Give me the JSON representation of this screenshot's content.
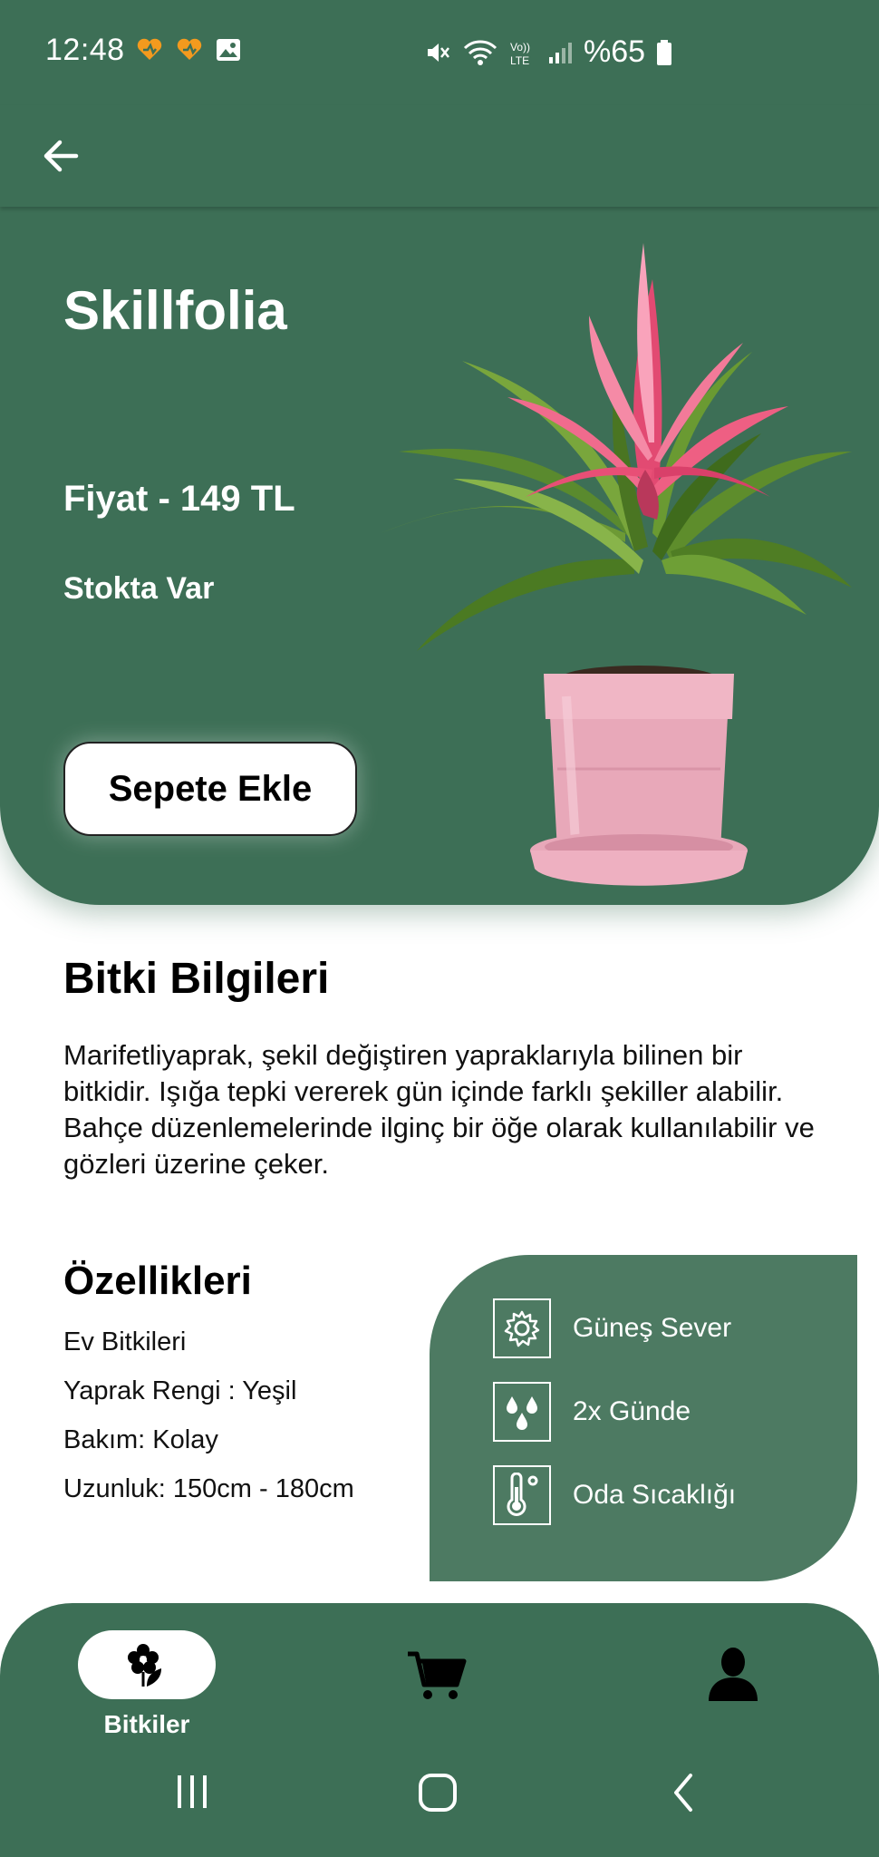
{
  "status_bar": {
    "time": "12:48",
    "battery": "%65",
    "left_icons": [
      "heart-notification-icon",
      "heart-notification-icon",
      "gallery-icon"
    ],
    "right_icons": [
      "mute-icon",
      "wifi-icon",
      "volte-icon",
      "signal-icon",
      "battery-icon"
    ]
  },
  "app_bar": {
    "back_icon": "arrow-left-icon"
  },
  "product": {
    "name": "Skillfolia",
    "price": "Fiyat - 149 TL",
    "stock": "Stokta Var",
    "add_to_cart": "Sepete Ekle",
    "image": "potted-pink-bromeliad"
  },
  "info": {
    "title": "Bitki Bilgileri",
    "description": "Marifetliyaprak, şekil değiştiren yapraklarıyla bilinen bir bitkidir. Işığa tepki vererek gün içinde farklı şekiller alabilir. Bahçe düzenlemelerinde ilginç bir öğe olarak kullanılabilir ve gözleri üzerine çeker."
  },
  "features": {
    "title": "Özellikleri",
    "items": [
      "Ev Bitkileri",
      "Yaprak Rengi : Yeşil",
      "Bakım: Kolay",
      "Uzunluk: 150cm - 180cm"
    ]
  },
  "care": [
    {
      "icon": "sun-icon",
      "label": "Güneş Sever"
    },
    {
      "icon": "water-drops-icon",
      "label": "2x Günde"
    },
    {
      "icon": "thermometer-icon",
      "label": "Oda Sıcaklığı"
    }
  ],
  "nav": {
    "plants_label": "Bitkiler",
    "items": [
      "flower-icon",
      "cart-icon",
      "profile-icon"
    ]
  },
  "colors": {
    "primary": "#3d6f56",
    "card": "#4d7a62",
    "white": "#ffffff"
  }
}
